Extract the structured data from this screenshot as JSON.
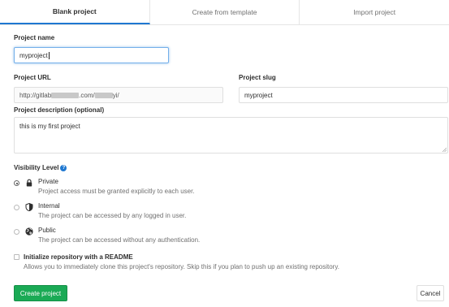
{
  "tabs": [
    {
      "label": "Blank project",
      "active": true
    },
    {
      "label": "Create from template",
      "active": false
    },
    {
      "label": "Import project",
      "active": false
    }
  ],
  "project_name": {
    "label": "Project name",
    "value": "myproject"
  },
  "project_url": {
    "label": "Project URL",
    "prefix": "http://gitlab",
    "middle": ".com/",
    "suffix": "yi/"
  },
  "project_slug": {
    "label": "Project slug",
    "value": "myproject"
  },
  "description": {
    "label": "Project description (optional)",
    "value": "this is my first project"
  },
  "visibility": {
    "label": "Visibility Level",
    "help_icon": "question-circle-icon",
    "options": [
      {
        "title": "Private",
        "description": "Project access must be granted explicitly to each user.",
        "icon": "lock-icon",
        "selected": true
      },
      {
        "title": "Internal",
        "description": "The project can be accessed by any logged in user.",
        "icon": "shield-icon",
        "selected": false
      },
      {
        "title": "Public",
        "description": "The project can be accessed without any authentication.",
        "icon": "globe-icon",
        "selected": false
      }
    ]
  },
  "readme": {
    "label": "Initialize repository with a README",
    "description": "Allows you to immediately clone this project's repository. Skip this if you plan to push up an existing repository."
  },
  "buttons": {
    "create": "Create project",
    "cancel": "Cancel"
  },
  "colors": {
    "accent": "#1f78d1",
    "create_button": "#1aaa55"
  }
}
